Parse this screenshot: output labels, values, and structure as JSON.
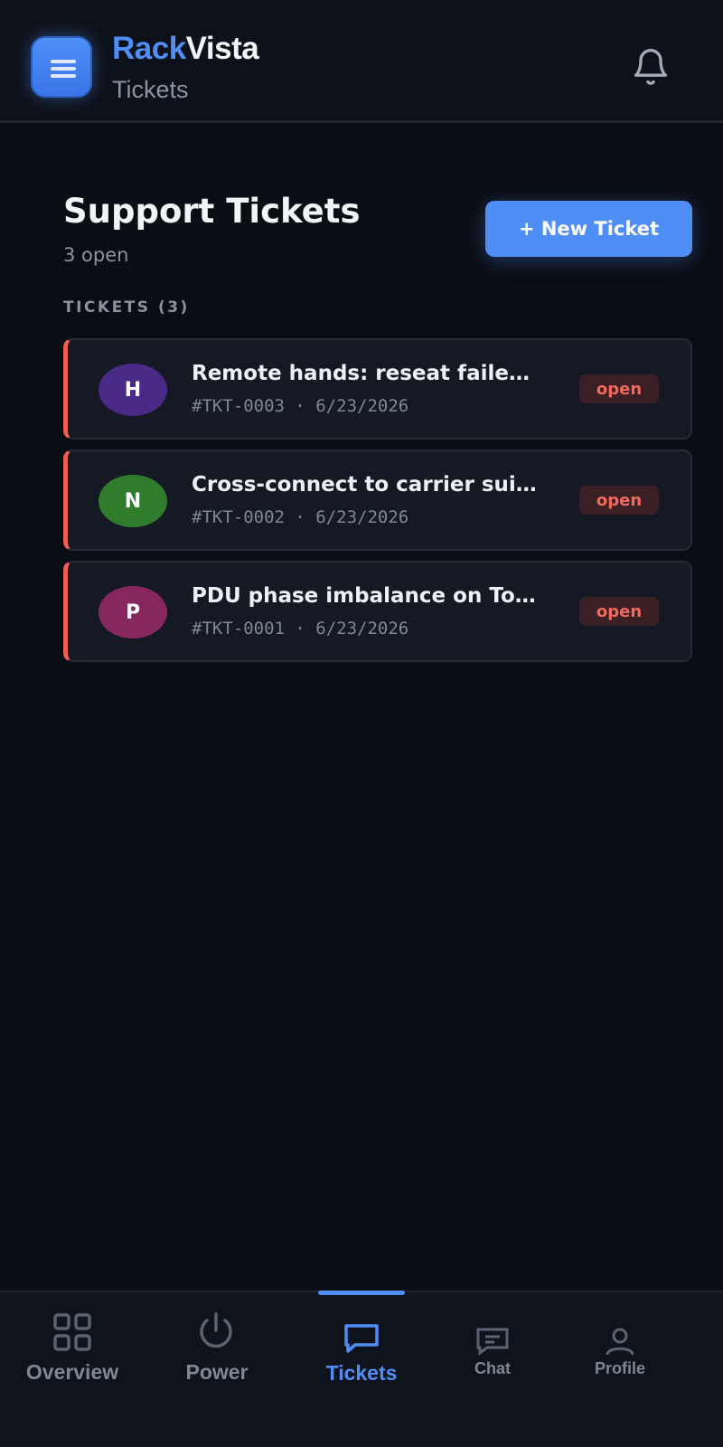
{
  "app": {
    "brand_part1": "Rack",
    "brand_part2": "Vista",
    "section": "Tickets"
  },
  "main": {
    "title": "Support Tickets",
    "subtitle": "3 open",
    "new_ticket_label": "+ New Ticket",
    "list_label": "TICKETS (3)"
  },
  "tickets": [
    {
      "avatar_letter": "H",
      "avatar_color": "#4a2a87",
      "title": "Remote hands: reseat failed drive",
      "meta": "#TKT-0003 · 6/23/2026",
      "status": "open"
    },
    {
      "avatar_letter": "N",
      "avatar_color": "#2f7d2c",
      "title": "Cross-connect to carrier suite",
      "meta": "#TKT-0002 · 6/23/2026",
      "status": "open"
    },
    {
      "avatar_letter": "P",
      "avatar_color": "#86285f",
      "title": "PDU phase imbalance on Tower",
      "meta": "#TKT-0001 · 6/23/2026",
      "status": "open"
    }
  ],
  "tabs": [
    {
      "label": "Overview",
      "icon": "grid-icon",
      "active": false
    },
    {
      "label": "Power",
      "icon": "power-icon",
      "active": false
    },
    {
      "label": "Tickets",
      "icon": "message-square-icon",
      "active": true
    },
    {
      "label": "Chat",
      "icon": "chat-icon",
      "active": false
    },
    {
      "label": "Profile",
      "icon": "user-icon",
      "active": false
    }
  ],
  "colors": {
    "accent": "#4f8ef7",
    "background": "#0a0d14",
    "card": "#141923",
    "status_open": "#f0695c"
  }
}
